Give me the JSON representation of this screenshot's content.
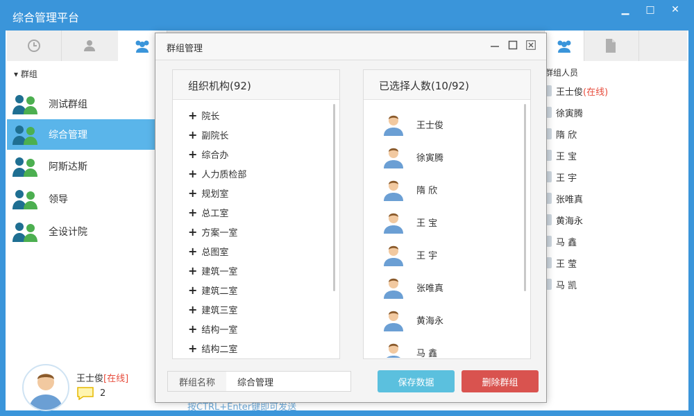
{
  "app": {
    "title": "综合管理平台"
  },
  "window_buttons": {
    "minimize": "▁",
    "maximize": "□",
    "close": "✕"
  },
  "sidebar": {
    "header": "群组",
    "groups": [
      {
        "label": "测试群组"
      },
      {
        "label": "综合管理",
        "selected": true
      },
      {
        "label": "阿斯达斯"
      },
      {
        "label": "领导"
      },
      {
        "label": "全设计院"
      }
    ]
  },
  "current_user": {
    "name": "王士俊",
    "status": "[在线]",
    "message_count": "2"
  },
  "members_panel": {
    "header": "群组人员",
    "members": [
      {
        "name": "王士俊",
        "status": "(在线)"
      },
      {
        "name": "徐寅腾",
        "status": ""
      },
      {
        "name": "隋 欣",
        "status": ""
      },
      {
        "name": "王 宝",
        "status": ""
      },
      {
        "name": "王 宇",
        "status": ""
      },
      {
        "name": "张唯真",
        "status": ""
      },
      {
        "name": "黄海永",
        "status": ""
      },
      {
        "name": "马 鑫",
        "status": ""
      },
      {
        "name": "王 莹",
        "status": ""
      },
      {
        "name": "马 凯",
        "status": ""
      }
    ]
  },
  "behind_hint": "按CTRL+Enter键即可发送",
  "modal": {
    "title": "群组管理",
    "org_panel": {
      "header": "组织机构(92)",
      "items": [
        "院长",
        "副院长",
        "综合办",
        "人力质检部",
        "规划室",
        "总工室",
        "方案一室",
        "总图室",
        "建筑一室",
        "建筑二室",
        "建筑三室",
        "结构一室",
        "结构二室"
      ]
    },
    "selected_panel": {
      "header": "已选择人数(10/92)",
      "items": [
        "王士俊",
        "徐寅腾",
        "隋 欣",
        "王 宝",
        "王 宇",
        "张唯真",
        "黄海永",
        "马 鑫"
      ]
    },
    "footer": {
      "name_label": "群组名称",
      "name_value": "综合管理",
      "save_label": "保存数据",
      "delete_label": "删除群组"
    }
  },
  "colors": {
    "accent": "#3a95da",
    "selected": "#5ab5ea",
    "save": "#5bc0de",
    "delete": "#d9534f",
    "online": "#e74c3c"
  }
}
